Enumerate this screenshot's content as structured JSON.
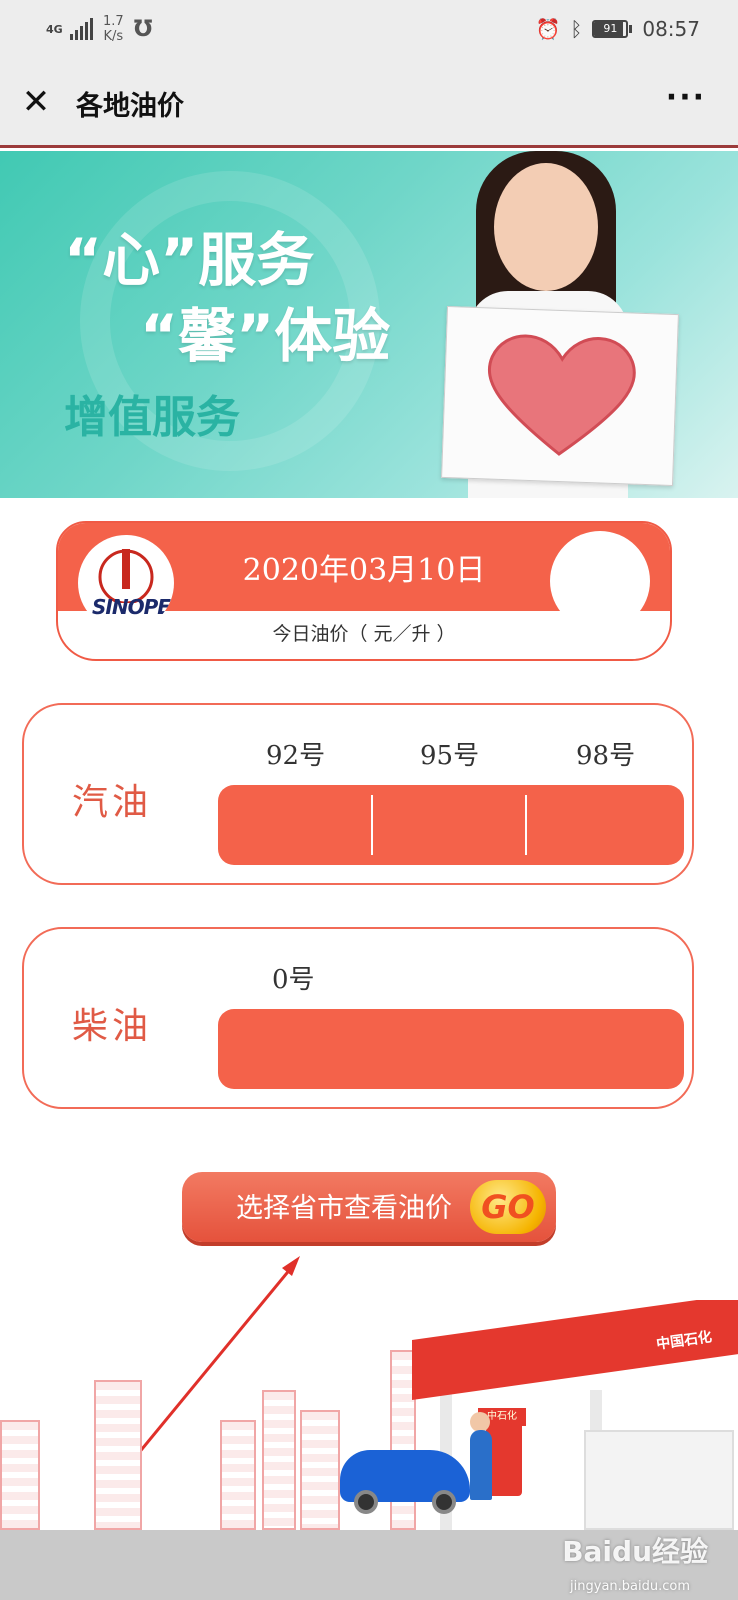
{
  "status_bar": {
    "network": "4G",
    "speed_value": "1.7",
    "speed_unit": "K/s",
    "battery": "91",
    "time": "08:57"
  },
  "title_bar": {
    "close_glyph": "✕",
    "title": "各地油价",
    "more_glyph": "···"
  },
  "banner": {
    "line1": "“心”服务",
    "line2": "“馨”体验",
    "line3": "增值服务"
  },
  "date_card": {
    "date": "2020年03月10日",
    "unit_label": "今日油价（ 元／升 ）",
    "logo_text": "SINOPEC"
  },
  "gasoline": {
    "name": "汽油",
    "grades": [
      "92号",
      "95号",
      "98号"
    ]
  },
  "diesel": {
    "name": "柴油",
    "grades": [
      "0号"
    ]
  },
  "go_button": {
    "label": "选择省市查看油价",
    "badge": "GO"
  },
  "watermark": {
    "brand": "Baidu经验",
    "url": "jingyan.baidu.com"
  },
  "colors": {
    "accent": "#f4624a",
    "header_bg": "#ededed",
    "banner_teal": "#41c9b3"
  },
  "icons": [
    "close-icon",
    "more-icon",
    "alarm-icon",
    "bluetooth-icon",
    "battery-icon",
    "signal-icon"
  ]
}
